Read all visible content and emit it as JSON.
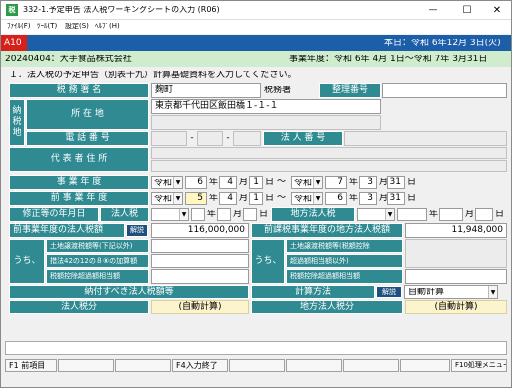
{
  "window": {
    "title": "332-1.予定申告 法人税ワーキングシートの入力 (R06)",
    "min": "—",
    "max": "☐",
    "close": "✕"
  },
  "menu": [
    {
      "label": "ﾌｧｲﾙ(F)"
    },
    {
      "label": "ﾂｰﾙ(T)"
    },
    {
      "label": "設定(S)"
    },
    {
      "label": "ﾍﾙﾌﾟ(H)"
    }
  ],
  "status": {
    "code": "A10",
    "date": "本日：令和 6年12月 3日(火)"
  },
  "company": {
    "name": "20240404：大手食品株式会社",
    "period": "事業年度：令和 6年 4月 1日〜令和 7年 3月31日"
  },
  "instruction": "１．法人税の予定申告（別表十九）計算基礎資料を入力してください。",
  "taxoffice": {
    "label": "税 務 署 名",
    "value": "麹町",
    "suffix": "税務署",
    "reg_label": "整理番号",
    "reg_value": ""
  },
  "nozeichi": {
    "group": "納\n税\n地",
    "addr_label": "所 在 地",
    "addr1": "東京都千代田区飯田橋１-１-１",
    "addr2": "",
    "tel_label": "電 話 番 号",
    "tel1": "",
    "tel_sep1": "-",
    "tel2": "",
    "tel_sep2": "-",
    "tel3": "",
    "corpno_label": "法 人 番 号",
    "corpno": ""
  },
  "rep": {
    "label": "代 表 者 住 所",
    "line1": "",
    "line2": ""
  },
  "jigyo": {
    "label": "事 業 年 度",
    "era1": "令和",
    "y1": "6",
    "m1": "4",
    "d1": "1",
    "era2": "令和",
    "y2": "7",
    "m2": "3",
    "d2": "31"
  },
  "zenki": {
    "label": "前 事 業 年 度",
    "era1": "令和",
    "y1": "5",
    "m1": "4",
    "d1": "1",
    "era2": "令和",
    "y2": "6",
    "m2": "3",
    "d2": "31"
  },
  "units": {
    "nen": "年",
    "tsuki": "月",
    "nichi": "日",
    "kara": "〜"
  },
  "shusei": {
    "label": "修正等の年月日",
    "houjin": "法人税",
    "chiho": "地方法人税"
  },
  "zenzei": {
    "label": "前事業年度の法人税額",
    "kaisetsu": "解説",
    "value": "116,000,000",
    "chiho_label": "前課税事業年度の地方法人税額",
    "chiho_value": "11,948,000"
  },
  "uchi": {
    "label": "うち、",
    "r1": "土地譲渡税額等(下記以外)",
    "r2": "措法42の12の８⑧の加算額",
    "r3": "税額控除超過額相当額",
    "c1": "土地譲渡税額等(税額控除",
    "c2": "超過額相当額以外)",
    "c3": "税額控除超過額相当額"
  },
  "nofu": {
    "label": "納付すべき法人税額等",
    "keisan": "計算方法",
    "kaisetsu": "解説",
    "method": "自動計算"
  },
  "bottom": {
    "houjin": "法人税分",
    "auto1": "(自動計算)",
    "chiho": "地方法人税分",
    "auto2": "(自動計算)"
  },
  "fkeys": {
    "f1": "F1 前項目",
    "f4": "F4入力終了",
    "f10": "F10処理メニュー"
  },
  "colors": {
    "teal": "#2f8a92",
    "status_red": "#d8201a",
    "status_blue": "#1c5fa8"
  }
}
